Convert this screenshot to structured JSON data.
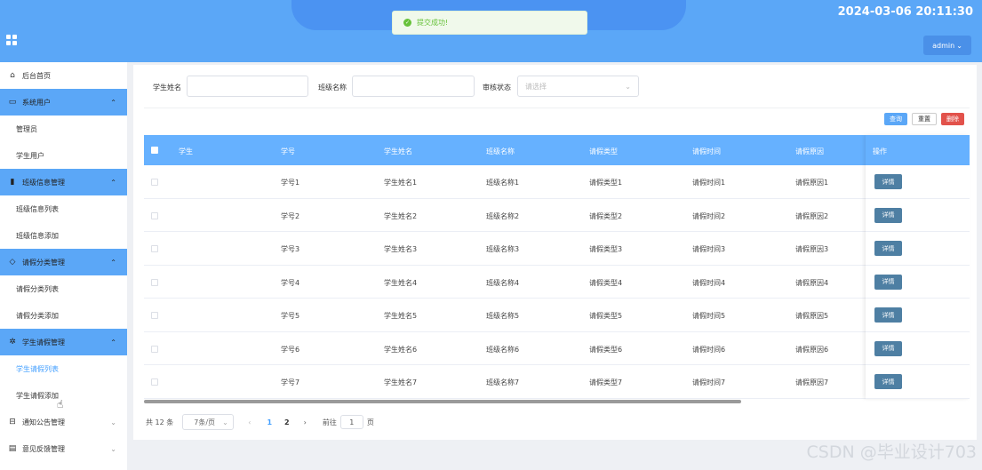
{
  "header": {
    "datetime": "2024-03-06 20:11:30",
    "user_label": "admin"
  },
  "toast": {
    "message": "提交成功!"
  },
  "sidebar": {
    "items": [
      {
        "label": "后台首页",
        "type": "home",
        "icon": "home-icon"
      },
      {
        "label": "系统用户",
        "type": "parent",
        "icon": "monitor-icon",
        "caret": "⌃"
      },
      {
        "label": "管理员",
        "type": "sub"
      },
      {
        "label": "学生用户",
        "type": "sub"
      },
      {
        "label": "班级信息管理",
        "type": "parent",
        "icon": "bookmark-icon",
        "caret": "⌃"
      },
      {
        "label": "班级信息列表",
        "type": "sub"
      },
      {
        "label": "班级信息添加",
        "type": "sub"
      },
      {
        "label": "请假分类管理",
        "type": "parent",
        "icon": "tag-icon",
        "caret": "⌃"
      },
      {
        "label": "请假分类列表",
        "type": "sub"
      },
      {
        "label": "请假分类添加",
        "type": "sub"
      },
      {
        "label": "学生请假管理",
        "type": "parent",
        "icon": "gear-icon",
        "caret": "⌃"
      },
      {
        "label": "学生请假列表",
        "type": "sub",
        "active": true
      },
      {
        "label": "学生请假添加",
        "type": "sub"
      },
      {
        "label": "通知公告管理",
        "type": "collapsed",
        "icon": "inbox-icon",
        "caret": "⌄"
      },
      {
        "label": "意见反馈管理",
        "type": "collapsed",
        "icon": "clipboard-icon",
        "caret": "⌄"
      }
    ]
  },
  "filters": {
    "student_name_label": "学生姓名",
    "class_name_label": "班级名称",
    "status_label": "审核状态",
    "status_placeholder": "请选择"
  },
  "actions": {
    "query": "查询",
    "reset": "重置",
    "delete": "删除"
  },
  "table": {
    "columns": [
      "学生",
      "学号",
      "学生姓名",
      "班级名称",
      "请假类型",
      "请假时间",
      "请假原因",
      "操作"
    ],
    "detail_label": "详情",
    "rows": [
      [
        "学号1",
        "学生姓名1",
        "班级名称1",
        "请假类型1",
        "请假时间1",
        "请假原因1"
      ],
      [
        "学号2",
        "学生姓名2",
        "班级名称2",
        "请假类型2",
        "请假时间2",
        "请假原因2"
      ],
      [
        "学号3",
        "学生姓名3",
        "班级名称3",
        "请假类型3",
        "请假时间3",
        "请假原因3"
      ],
      [
        "学号4",
        "学生姓名4",
        "班级名称4",
        "请假类型4",
        "请假时间4",
        "请假原因4"
      ],
      [
        "学号5",
        "学生姓名5",
        "班级名称5",
        "请假类型5",
        "请假时间5",
        "请假原因5"
      ],
      [
        "学号6",
        "学生姓名6",
        "班级名称6",
        "请假类型6",
        "请假时间6",
        "请假原因6"
      ],
      [
        "学号7",
        "学生姓名7",
        "班级名称7",
        "请假类型7",
        "请假时间7",
        "请假原因7"
      ]
    ]
  },
  "pagination": {
    "total": "共 12 条",
    "page_size": "7条/页",
    "pages": [
      "1",
      "2"
    ],
    "current": "1",
    "goto_label": "前往",
    "goto_value": "1",
    "page_suffix": "页",
    "prev": "‹",
    "next": "›"
  },
  "watermark": "CSDN @毕业设计703"
}
